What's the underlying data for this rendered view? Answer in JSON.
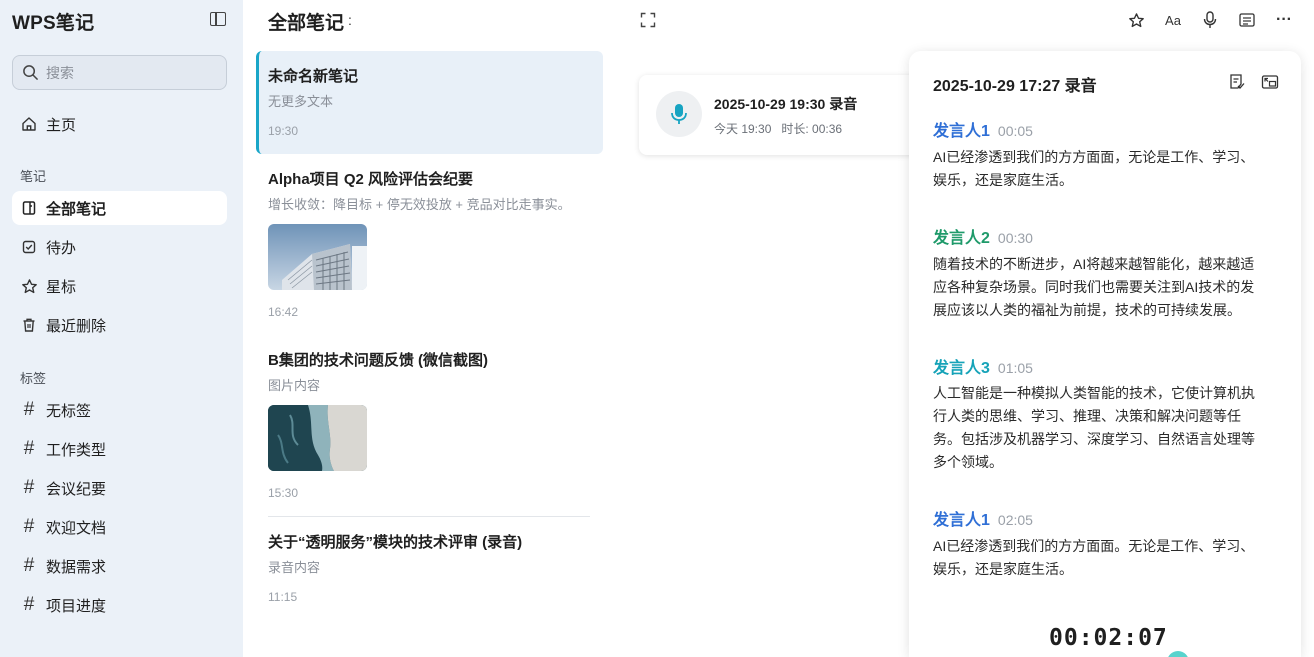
{
  "app": {
    "title": "WPS笔记"
  },
  "sidebar": {
    "search_placeholder": "搜索",
    "home": "主页",
    "notes_section": "笔记",
    "notes_items": [
      {
        "label": "全部笔记",
        "icon": "note-icon"
      },
      {
        "label": "待办",
        "icon": "checkbox-icon"
      },
      {
        "label": "星标",
        "icon": "star-icon"
      },
      {
        "label": "最近删除",
        "icon": "trash-icon"
      }
    ],
    "tags_section": "标签",
    "tags": [
      "无标签",
      "工作类型",
      "会议纪要",
      "欢迎文档",
      "数据需求",
      "项目进度"
    ]
  },
  "list": {
    "header": "全部笔记",
    "header_more": ":",
    "notes": [
      {
        "title": "未命名新笔记",
        "subtitle": "无更多文本",
        "time": "19:30"
      },
      {
        "title": "Alpha项目 Q2 风险评估会纪要",
        "subtitle": "增长收敛：降目标 + 停无效投放 + 竞品对比走事实。",
        "time": "16:42",
        "image": "building-photo"
      },
      {
        "title": "B集团的技术问题反馈 (微信截图)",
        "subtitle": "图片内容",
        "time": "15:30",
        "image": "coast-photo"
      },
      {
        "title": "关于“透明服务”模块的技术评审 (录音)",
        "subtitle": "录音内容",
        "time": "11:15"
      }
    ]
  },
  "recording_card": {
    "title": "2025-10-29 19:30 录音",
    "day": "今天 19:30",
    "duration": "时长: 00:36"
  },
  "toolbar": {
    "font_label": "Aa",
    "more_label": "···"
  },
  "transcript": {
    "title": "2025-10-29 17:27 录音",
    "entries": [
      {
        "speaker": "发言人1",
        "time": "00:05",
        "color": "#2f6fd6",
        "text": "AI已经渗透到我们的方方面面，无论是工作、学习、娱乐，还是家庭生活。"
      },
      {
        "speaker": "发言人2",
        "time": "00:30",
        "color": "#1f9a6a",
        "text": "随着技术的不断进步，AI将越来越智能化，越来越适应各种复杂场景。同时我们也需要关注到AI技术的发展应该以人类的福祉为前提，技术的可持续发展。"
      },
      {
        "speaker": "发言人3",
        "time": "01:05",
        "color": "#16a3b8",
        "text": "人工智能是一种模拟人类智能的技术，它使计算机执行人类的思维、学习、推理、决策和解决问题等任务。包括涉及机器学习、深度学习、自然语言处理等多个领域。"
      },
      {
        "speaker": "发言人1",
        "time": "02:05",
        "color": "#2f6fd6",
        "text": "AI已经渗透到我们的方方面面。无论是工作、学习、娱乐，还是家庭生活。"
      }
    ],
    "timer": "00:02:07"
  }
}
